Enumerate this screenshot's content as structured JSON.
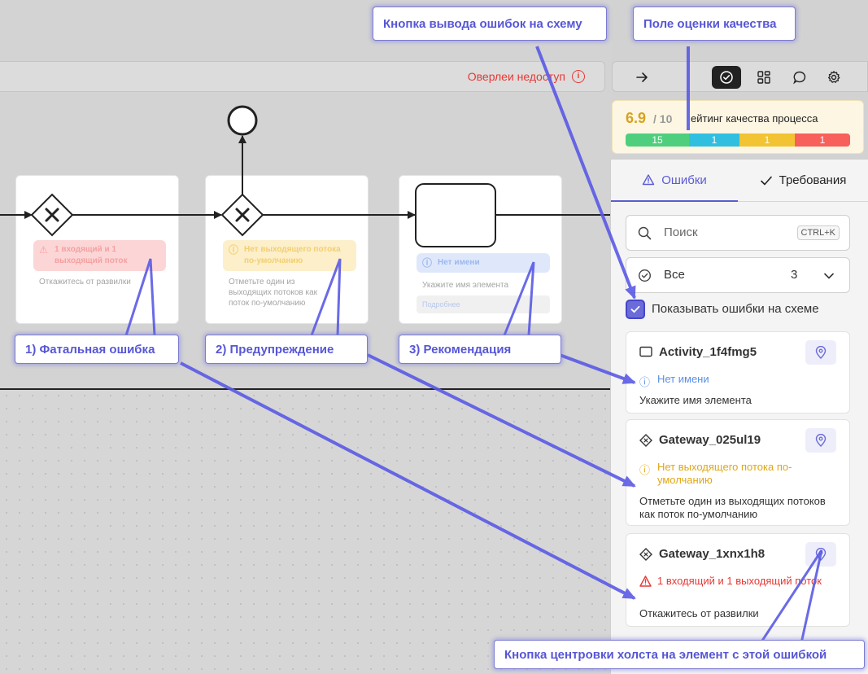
{
  "toolbar": {
    "overlay_warning": "Оверлеи недоступ",
    "info_icon": "info-icon",
    "tools": [
      "arrow-right-icon",
      "check-circle-icon",
      "grid-icon",
      "chat-icon",
      "gear-icon"
    ]
  },
  "quality": {
    "score": "6.9",
    "max": "/ 10",
    "label": "ейтинг качества процесса",
    "segments": [
      {
        "value": "15",
        "color": "#4fcf7d"
      },
      {
        "value": "1",
        "color": "#31bfe0"
      },
      {
        "value": "1",
        "color": "#f2c333"
      },
      {
        "value": "1",
        "color": "#f7605b"
      }
    ]
  },
  "diagram": {
    "cards": [
      {
        "badge": "1 входящий и 1 выходящий поток",
        "hint": "Откажитесь от развилки"
      },
      {
        "badge": "Нет выходящего потока по-умолчанию",
        "hint": "Отметьте один из выходящих потоков как поток по-умолчанию"
      },
      {
        "badge": "Нет имени",
        "hint": "Укажите имя элемента",
        "more": "Подробнее"
      }
    ]
  },
  "callouts": {
    "show_errors_button": "Кнопка вывода ошибок на схему",
    "quality_field": "Поле оценки качества",
    "fatal": "1) Фатальная ошибка",
    "warning": "2) Предупреждение",
    "recommendation": "3) Рекомендация",
    "center_button": "Кнопка центровки холста на элемент с этой ошибкой"
  },
  "panel": {
    "tabs": {
      "errors": "Ошибки",
      "requirements": "Требования"
    },
    "search": {
      "placeholder": "Поиск",
      "shortcut": "CTRL+K"
    },
    "filter": {
      "label": "Все",
      "count": "3"
    },
    "show_errors_label": "Показывать ошибки на схеме",
    "issues": [
      {
        "title": "Activity_1f4fmg5",
        "severity": "recommendation",
        "message": "Нет имени",
        "hint": "Укажите имя элемента",
        "color": "#5b8fe6"
      },
      {
        "title": "Gateway_025ul19",
        "severity": "warning",
        "message": "Нет выходящего потока по-умолчанию",
        "hint": "Отметьте один из выходящих потоков как поток по-умолчанию",
        "color": "#e0a716"
      },
      {
        "title": "Gateway_1xnx1h8",
        "severity": "fatal",
        "message": "1 входящий и 1 выходящий поток",
        "hint": "Откажитесь от развилки",
        "color": "#e53935"
      }
    ]
  }
}
